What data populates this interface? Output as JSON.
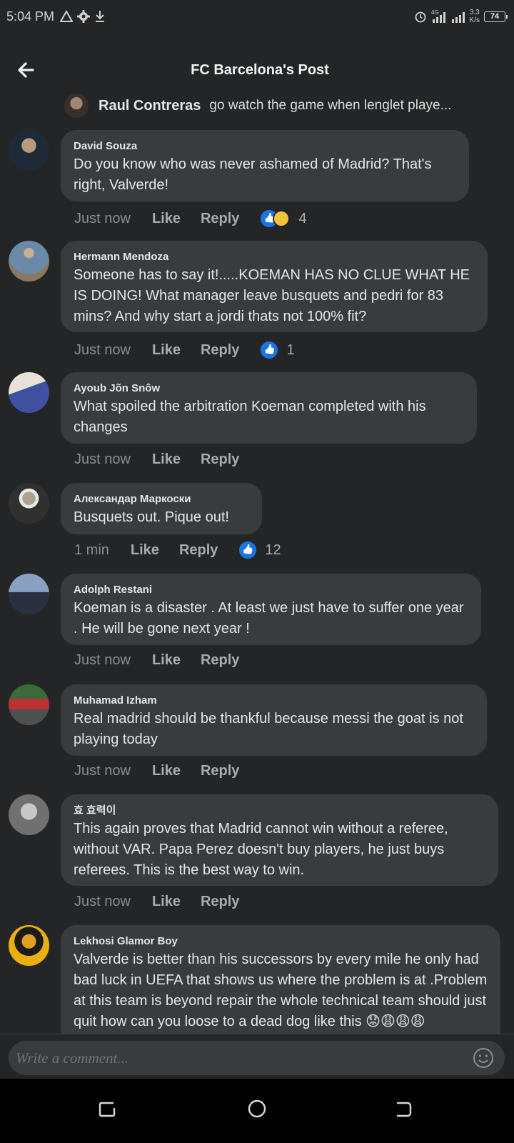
{
  "status_bar": {
    "time": "5:04 PM",
    "network": "4G",
    "net_speed_value": "3.3",
    "net_speed_unit": "K/s",
    "battery": "74"
  },
  "header": {
    "title": "FC Barcelona's Post"
  },
  "reply_context": {
    "name": "Raul Contreras",
    "text": "go watch the game when lenglet playe..."
  },
  "comments": [
    {
      "name": "David Souza",
      "text": "Do you know who was never ashamed of Madrid? That's right, Valverde!",
      "time": "Just now",
      "like": "Like",
      "reply": "Reply",
      "reactions": [
        "like",
        "haha"
      ],
      "count": "4"
    },
    {
      "name": "Hermann Mendoza",
      "text": "Someone has to say it!.....KOEMAN HAS NO CLUE WHAT HE IS DOING! What manager leave busquets and pedri for 83 mins? And why start a jordi thats not 100% fit?",
      "time": "Just now",
      "like": "Like",
      "reply": "Reply",
      "reactions": [
        "like"
      ],
      "count": "1"
    },
    {
      "name": "Ayoub Jõn Snôw",
      "text": "What spoiled the arbitration Koeman completed with his changes",
      "time": "Just now",
      "like": "Like",
      "reply": "Reply",
      "reactions": [],
      "count": ""
    },
    {
      "name": "Александар Маркоски",
      "text": "Busquets out. Pique out!",
      "time": "1 min",
      "like": "Like",
      "reply": "Reply",
      "reactions": [
        "like"
      ],
      "count": "12"
    },
    {
      "name": "Adolph Restani",
      "text": "Koeman is a disaster . At least we just have to suffer one year . He will be gone next year !",
      "time": "Just now",
      "like": "Like",
      "reply": "Reply",
      "reactions": [],
      "count": ""
    },
    {
      "name": "Muhamad Izham",
      "text": "Real madrid should be thankful because messi the goat is not playing today",
      "time": "Just now",
      "like": "Like",
      "reply": "Reply",
      "reactions": [],
      "count": ""
    },
    {
      "name": "효 효력이",
      "text": "This again proves that Madrid cannot win without a referee, without VAR. Papa Perez doesn't buy players, he just buys referees. This is the best way to win.",
      "time": "Just now",
      "like": "Like",
      "reply": "Reply",
      "reactions": [],
      "count": ""
    },
    {
      "name": "Lekhosi Glamor Boy",
      "text": "Valverde is better than his successors by every mile he only had bad luck in UEFA that shows us where the problem is at .Problem at this team is beyond repair the whole technical team should just quit how can you loose to a dead dog like this 😟😩😩😩",
      "time": "",
      "like": "",
      "reply": "",
      "reactions": [],
      "count": ""
    }
  ],
  "composer": {
    "placeholder": "Write a comment..."
  },
  "colors": {
    "background": "#242526",
    "bubble": "#3a3b3c",
    "like_blue": "#1b74e4"
  }
}
